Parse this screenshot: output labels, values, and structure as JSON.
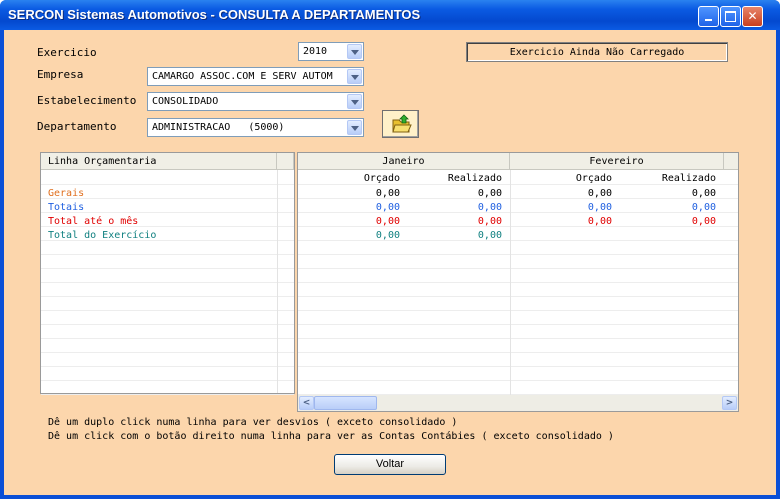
{
  "window": {
    "title": "SERCON Sistemas Automotivos - CONSULTA A DEPARTAMENTOS"
  },
  "form": {
    "exercicio_label": "Exercicio",
    "exercicio_value": "2010",
    "empresa_label": "Empresa",
    "empresa_value": "CAMARGO ASSOC.COM E SERV AUTOM",
    "estabelecimento_label": "Estabelecimento",
    "estabelecimento_value": "CONSOLIDADO",
    "departamento_label": "Departamento",
    "departamento_value": "ADMINISTRACAO   (5000)",
    "status_text": "Exercicio Ainda Não Carregado",
    "open_button_icon": "folder-open-icon"
  },
  "grid_left": {
    "header": "Linha Orçamentaria",
    "rows": [
      "Gerais",
      "Totais",
      "Total até o mês",
      "Total do Exercício"
    ],
    "row_colors": [
      "#e07020",
      "#2060e0",
      "#e00000",
      "#108080"
    ]
  },
  "grid_right": {
    "months": [
      "Janeiro",
      "Fevereiro"
    ],
    "sub_headers": [
      "Orçado",
      "Realizado",
      "Orçado",
      "Realizado"
    ],
    "rows": [
      [
        "0,00",
        "0,00",
        "0,00",
        "0,00"
      ],
      [
        "0,00",
        "0,00",
        "0,00",
        "0,00"
      ],
      [
        "0,00",
        "0,00",
        "0,00",
        "0,00"
      ],
      [
        "0,00",
        "0,00",
        "",
        ""
      ]
    ],
    "row_colors": [
      "#000000",
      "#2060e0",
      "#e00000",
      "#108080"
    ]
  },
  "hints": {
    "line1": "Dê um duplo click numa linha para ver desvios ( exceto consolidado )",
    "line2": "Dê um click com o botão direito numa linha para ver as Contas Contábies ( exceto consolidado )"
  },
  "buttons": {
    "voltar": "Voltar"
  }
}
